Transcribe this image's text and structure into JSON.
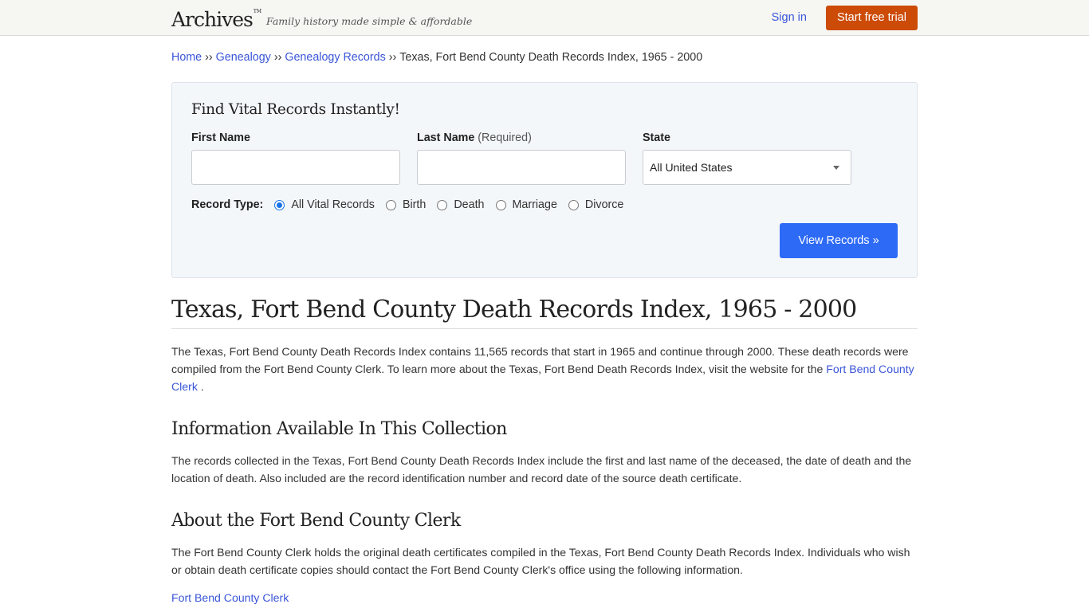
{
  "header": {
    "logo": "Archives",
    "logo_tm": "TM",
    "tagline": "Family history made simple & affordable",
    "signin_label": "Sign in",
    "trial_label": "Start free trial"
  },
  "breadcrumb": {
    "items": [
      "Home",
      "Genealogy",
      "Genealogy Records"
    ],
    "separator": "››",
    "current": "Texas, Fort Bend County Death Records Index, 1965 - 2000"
  },
  "search": {
    "title": "Find Vital Records Instantly!",
    "first_name_label": "First Name",
    "first_name_value": "",
    "last_name_label": "Last Name",
    "last_name_required": "(Required)",
    "last_name_value": "",
    "state_label": "State",
    "state_selected": "All United States",
    "record_type_label": "Record Type:",
    "record_types": [
      "All Vital Records",
      "Birth",
      "Death",
      "Marriage",
      "Divorce"
    ],
    "record_type_selected": "All Vital Records",
    "submit_label": "View Records »"
  },
  "article": {
    "title": "Texas, Fort Bend County Death Records Index, 1965 - 2000",
    "intro_text": "The Texas, Fort Bend County Death Records Index contains 11,565 records that start in 1965 and continue through 2000. These death records were compiled from the Fort Bend County Clerk. To learn more about the Texas, Fort Bend Death Records Index, visit the website for the ",
    "intro_link": "Fort Bend County Clerk",
    "intro_tail": " .",
    "section1_title": "Information Available In This Collection",
    "section1_text": "The records collected in the Texas, Fort Bend County Death Records Index include the first and last name of the deceased, the date of death and the location of death. Also included are the record identification number and record date of the source death certificate.",
    "section2_title": "About the Fort Bend County Clerk",
    "section2_text": "The Fort Bend County Clerk holds the original death certificates compiled in the Texas, Fort Bend County Death Records Index. Individuals who wish or obtain death certificate copies should contact the Fort Bend County Clerk's office using the following information.",
    "clerk_link": "Fort Bend County Clerk"
  },
  "colors": {
    "accent_orange": "#cc4b06",
    "primary_blue": "#2d6af6",
    "link_blue": "#3a55d8"
  }
}
